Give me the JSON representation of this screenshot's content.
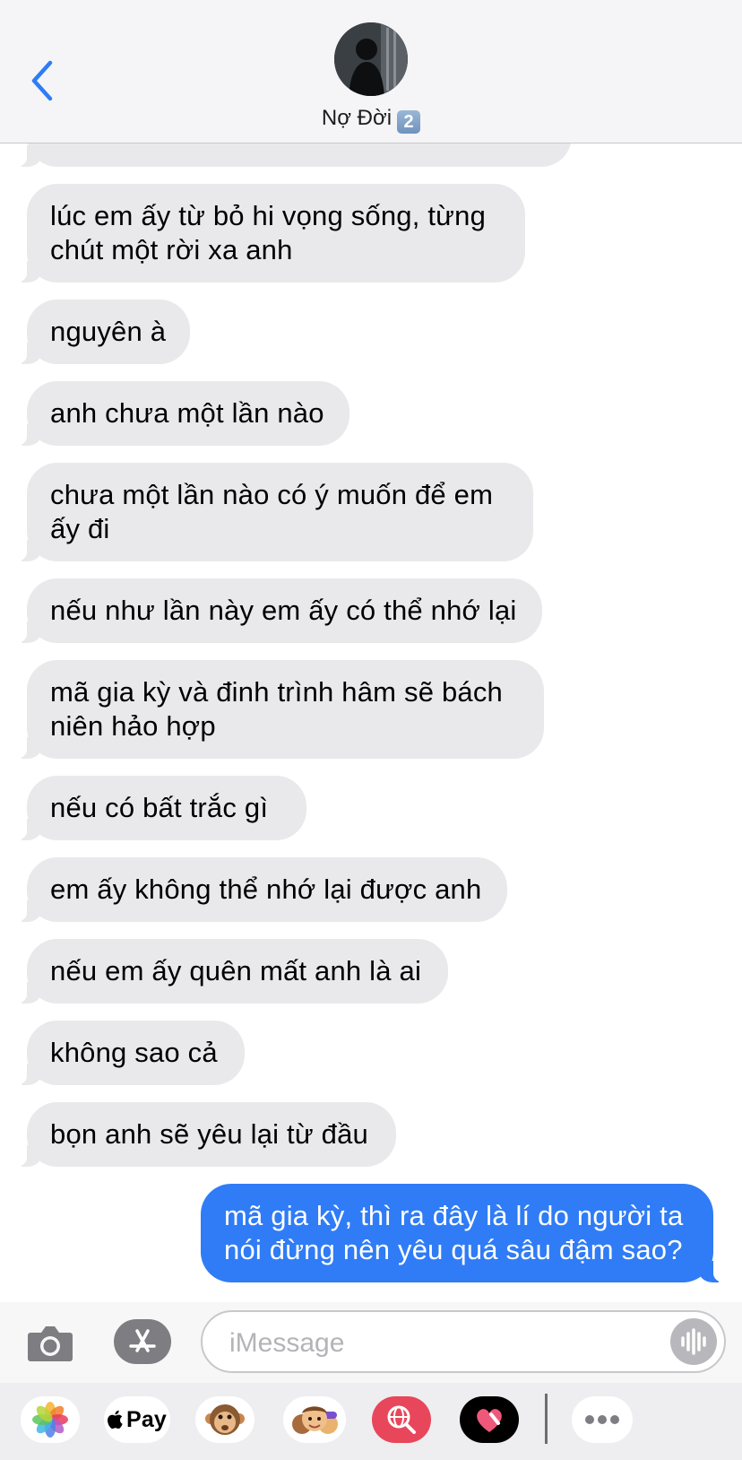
{
  "header": {
    "back_icon": "chevron-left-icon",
    "contact_name": "Nợ Đời",
    "badge": "2"
  },
  "messages": [
    {
      "side": "received",
      "text": "lúc em ấy từ bỏ hi vọng sống, từng chút một rời xa anh"
    },
    {
      "side": "received",
      "text": "nguyên à"
    },
    {
      "side": "received",
      "text": "anh chưa một lần nào"
    },
    {
      "side": "received",
      "text": "chưa một lần nào có ý muốn để em ấy đi"
    },
    {
      "side": "received",
      "text": "nếu như lần này em ấy có thể nhớ lại"
    },
    {
      "side": "received",
      "text": "mã gia kỳ và đinh trình hâm sẽ bách niên hảo hợp"
    },
    {
      "side": "received",
      "text": "nếu có bất trắc gì"
    },
    {
      "side": "received",
      "text": "em ấy không thể nhớ lại được anh"
    },
    {
      "side": "received",
      "text": "nếu em ấy quên mất anh là ai"
    },
    {
      "side": "received",
      "text": "không sao cả"
    },
    {
      "side": "received",
      "text": "bọn anh sẽ yêu lại từ đầu"
    },
    {
      "side": "sent",
      "text": "mã gia kỳ, thì ra đây là lí do người ta nói đừng nên yêu quá sâu đậm sao?"
    }
  ],
  "compose": {
    "camera_icon": "camera-icon",
    "appstore_icon": "app-store-icon",
    "placeholder": "iMessage",
    "value": "",
    "voice_icon": "waveform-icon"
  },
  "app_drawer": {
    "apps": [
      {
        "name": "photos",
        "icon": "photos-icon"
      },
      {
        "name": "apple-pay",
        "label": "Pay",
        "icon": "apple-icon"
      },
      {
        "name": "animoji",
        "icon": "monkey-icon"
      },
      {
        "name": "memoji",
        "icon": "memoji-icon"
      },
      {
        "name": "search",
        "icon": "globe-search-icon"
      },
      {
        "name": "digital-touch",
        "icon": "heart-icon"
      },
      {
        "name": "more",
        "icon": "more-icon"
      }
    ]
  },
  "colors": {
    "received_bubble": "#e9e9eb",
    "sent_bubble": "#2f7cf6",
    "accent": "#2f7cf6"
  }
}
